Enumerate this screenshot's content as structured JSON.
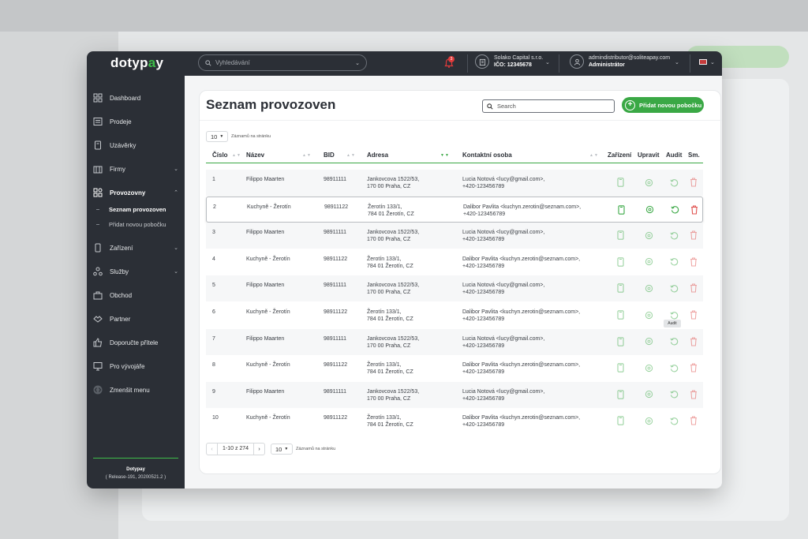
{
  "app": {
    "logo_main": "dotyp",
    "logo_accent": "a",
    "logo_end": "y"
  },
  "header": {
    "search_placeholder": "Vyhledávání",
    "notifications_count": "3",
    "company_name": "Solako Capital s.r.o.",
    "company_ico": "IČO: 12345678",
    "user_email": "admindistributor@soliteapay.com",
    "user_role": "Administrátor"
  },
  "sidebar": {
    "items": [
      {
        "label": "Dashboard",
        "icon": "dashboard-icon",
        "chevron": ""
      },
      {
        "label": "Prodeje",
        "icon": "sales-icon",
        "chevron": ""
      },
      {
        "label": "Uzávěrky",
        "icon": "closure-icon",
        "chevron": ""
      },
      {
        "label": "Firmy",
        "icon": "company-icon",
        "chevron": "⌄"
      },
      {
        "label": "Provozovny",
        "icon": "branch-icon",
        "chevron": "⌃"
      },
      {
        "label": "Zařízení",
        "icon": "device-icon",
        "chevron": "⌄"
      },
      {
        "label": "Služby",
        "icon": "services-icon",
        "chevron": "⌄"
      },
      {
        "label": "Obchod",
        "icon": "shop-icon",
        "chevron": ""
      },
      {
        "label": "Partner",
        "icon": "partner-icon",
        "chevron": ""
      },
      {
        "label": "Doporučte přítele",
        "icon": "thumbs-up-icon",
        "chevron": ""
      },
      {
        "label": "Pro vývojáře",
        "icon": "monitor-icon",
        "chevron": ""
      },
      {
        "label": "Zmenšit menu",
        "icon": "collapse-icon",
        "chevron": ""
      }
    ],
    "subitems": [
      {
        "label": "Seznam provozoven"
      },
      {
        "label": "Přidat novou pobočku"
      }
    ],
    "footer_title": "Dotypay",
    "footer_release": "( Release-191, 20200521.2 )"
  },
  "main": {
    "title": "Seznam provozoven",
    "search_placeholder": "Search",
    "add_button": "Přidat novou pobočku",
    "per_page_value": "10",
    "per_page_label": "Záznamů na stránku",
    "columns": [
      "Číslo",
      "Název",
      "BID",
      "Adresa",
      "Kontaktní osoba",
      "Zařízení",
      "Upravit",
      "Audit",
      "Sm."
    ],
    "rows": [
      {
        "num": "1",
        "name": "Filippo Maarten",
        "bid": "98911111",
        "addr1": "Jankovcova 1522/53,",
        "addr2": "170 00 Praha, CZ",
        "contact1": "Lucia Notová <lucy@gmail.com>,",
        "contact2": "+420-123456789"
      },
      {
        "num": "2",
        "name": "Kuchyně - Žerotín",
        "bid": "98911122",
        "addr1": "Žerotín 133/1,",
        "addr2": "784 01 Žerotín, CZ",
        "contact1": "Dalibor Pavlita <kuchyn.zerotin@seznam.com>,",
        "contact2": "+420-123456789"
      },
      {
        "num": "3",
        "name": "Filippo Maarten",
        "bid": "98911111",
        "addr1": "Jankovcova 1522/53,",
        "addr2": "170 00 Praha, CZ",
        "contact1": "Lucia Notová <lucy@gmail.com>,",
        "contact2": "+420-123456789"
      },
      {
        "num": "4",
        "name": "Kuchyně - Žerotín",
        "bid": "98911122",
        "addr1": "Žerotín 133/1,",
        "addr2": "784 01 Žerotín, CZ",
        "contact1": "Dalibor Pavlita <kuchyn.zerotin@seznam.com>,",
        "contact2": "+420-123456789"
      },
      {
        "num": "5",
        "name": "Filippo Maarten",
        "bid": "98911111",
        "addr1": "Jankovcova 1522/53,",
        "addr2": "170 00 Praha, CZ",
        "contact1": "Lucia Notová <lucy@gmail.com>,",
        "contact2": "+420-123456789"
      },
      {
        "num": "6",
        "name": "Kuchyně - Žerotín",
        "bid": "98911122",
        "addr1": "Žerotín 133/1,",
        "addr2": "784 01 Žerotín, CZ",
        "contact1": "Dalibor Pavlita <kuchyn.zerotin@seznam.com>,",
        "contact2": "+420-123456789"
      },
      {
        "num": "7",
        "name": "Filippo Maarten",
        "bid": "98911111",
        "addr1": "Jankovcova 1522/53,",
        "addr2": "170 00 Praha, CZ",
        "contact1": "Lucia Notová <lucy@gmail.com>,",
        "contact2": "+420-123456789"
      },
      {
        "num": "8",
        "name": "Kuchyně - Žerotín",
        "bid": "98911122",
        "addr1": "Žerotín 133/1,",
        "addr2": "784 01 Žerotín, CZ",
        "contact1": "Dalibor Pavlita <kuchyn.zerotin@seznam.com>,",
        "contact2": "+420-123456789"
      },
      {
        "num": "9",
        "name": "Filippo Maarten",
        "bid": "98911111",
        "addr1": "Jankovcova 1522/53,",
        "addr2": "170 00 Praha, CZ",
        "contact1": "Lucia Notová <lucy@gmail.com>,",
        "contact2": "+420-123456789"
      },
      {
        "num": "10",
        "name": "Kuchyně - Žerotín",
        "bid": "98911122",
        "addr1": "Žerotín 133/1,",
        "addr2": "784 01 Žerotín, CZ",
        "contact1": "Dalibor Pavlita <kuchyn.zerotin@seznam.com>,",
        "contact2": "+420-123456789"
      }
    ],
    "tooltip_audit": "Audit",
    "pagination_info": "1-10 z 274",
    "pagination_per_page": "10",
    "pagination_per_page_label": "Záznamů na stránku"
  },
  "colors": {
    "accent": "#3aa845",
    "dark": "#2b2f36",
    "delete": "#e0524f"
  }
}
